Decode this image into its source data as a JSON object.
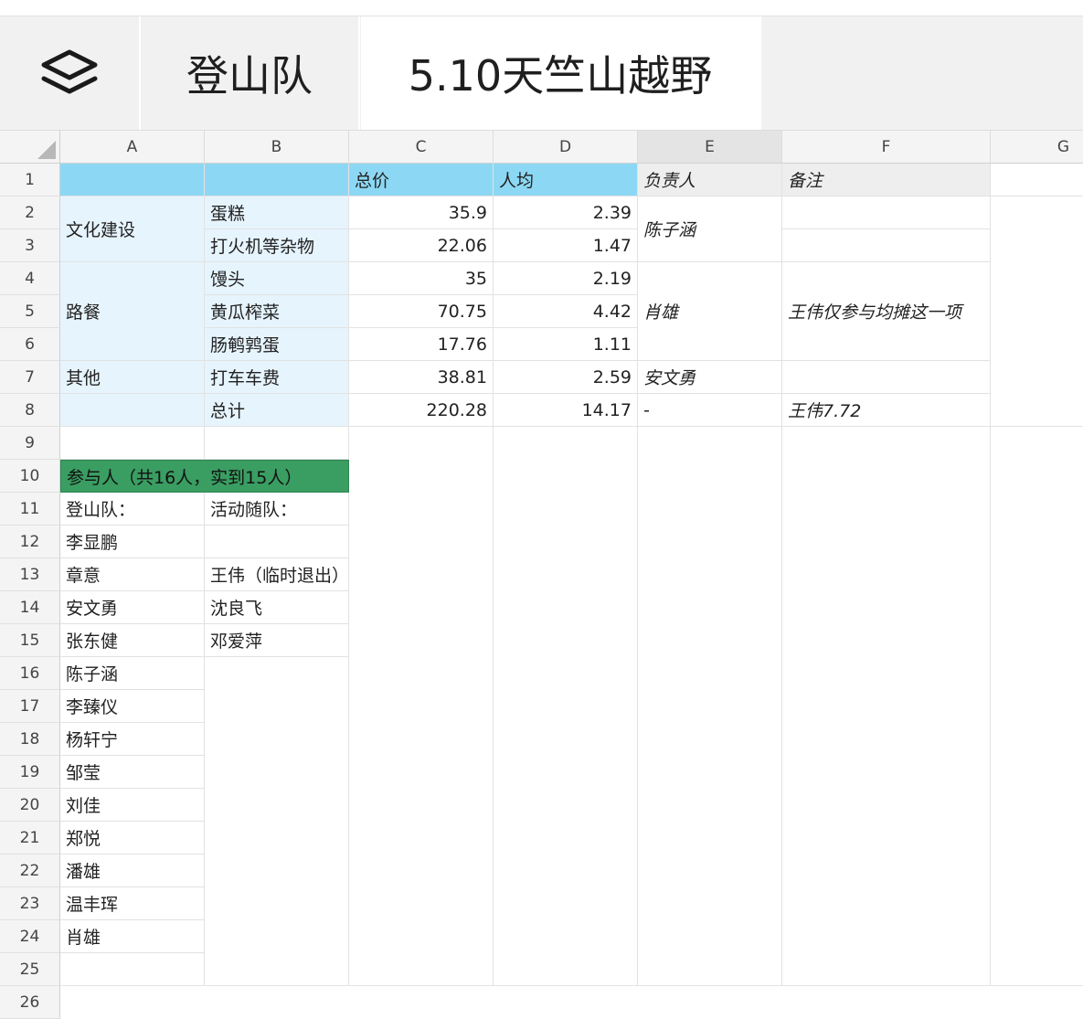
{
  "tabs": [
    {
      "label": "登山队",
      "active": false
    },
    {
      "label": "5.10天竺山越野",
      "active": true
    }
  ],
  "columns": [
    "A",
    "B",
    "C",
    "D",
    "E",
    "F",
    "G"
  ],
  "rows": [
    "1",
    "2",
    "3",
    "4",
    "5",
    "6",
    "7",
    "8",
    "9",
    "10",
    "11",
    "12",
    "13",
    "14",
    "15",
    "16",
    "17",
    "18",
    "19",
    "20",
    "21",
    "22",
    "23",
    "24",
    "25",
    "26"
  ],
  "header_row": {
    "c": "总价",
    "d": "人均",
    "e": "负责人",
    "f": "备注"
  },
  "groups": {
    "culture": "文化建设",
    "meal": "路餐",
    "other": "其他"
  },
  "items": [
    {
      "name": "蛋糕",
      "total": "35.9",
      "avg": "2.39"
    },
    {
      "name": "打火机等杂物",
      "total": "22.06",
      "avg": "1.47"
    },
    {
      "name": "馒头",
      "total": "35",
      "avg": "2.19"
    },
    {
      "name": "黄瓜榨菜",
      "total": "70.75",
      "avg": "4.42"
    },
    {
      "name": "肠鹌鹑蛋",
      "total": "17.76",
      "avg": "1.11"
    },
    {
      "name": "打车车费",
      "total": "38.81",
      "avg": "2.59"
    },
    {
      "name": "总计",
      "total": "220.28",
      "avg": "14.17"
    }
  ],
  "owners": {
    "culture": "陈子涵",
    "meal": "肖雄",
    "other": "安文勇",
    "total": "-"
  },
  "notes": {
    "meal": "王伟仅参与均摊这一项",
    "total": "王伟7.72"
  },
  "participants_header": "参与人（共16人，实到15人）",
  "team_label": "登山队：",
  "guest_label": "活动随队：",
  "team_members": [
    "李显鹏",
    "章意",
    "安文勇",
    "张东健",
    "陈子涵",
    "李臻仪",
    "杨轩宁",
    "邹莹",
    "刘佳",
    "郑悦",
    "潘雄",
    "温丰珲",
    "肖雄"
  ],
  "guests": [
    "王伟（临时退出）",
    "沈良飞",
    "邓爱萍"
  ],
  "colors": {
    "header_blue": "#8cd8f4",
    "light_blue": "#e6f4fd",
    "green": "#3a9d62"
  }
}
